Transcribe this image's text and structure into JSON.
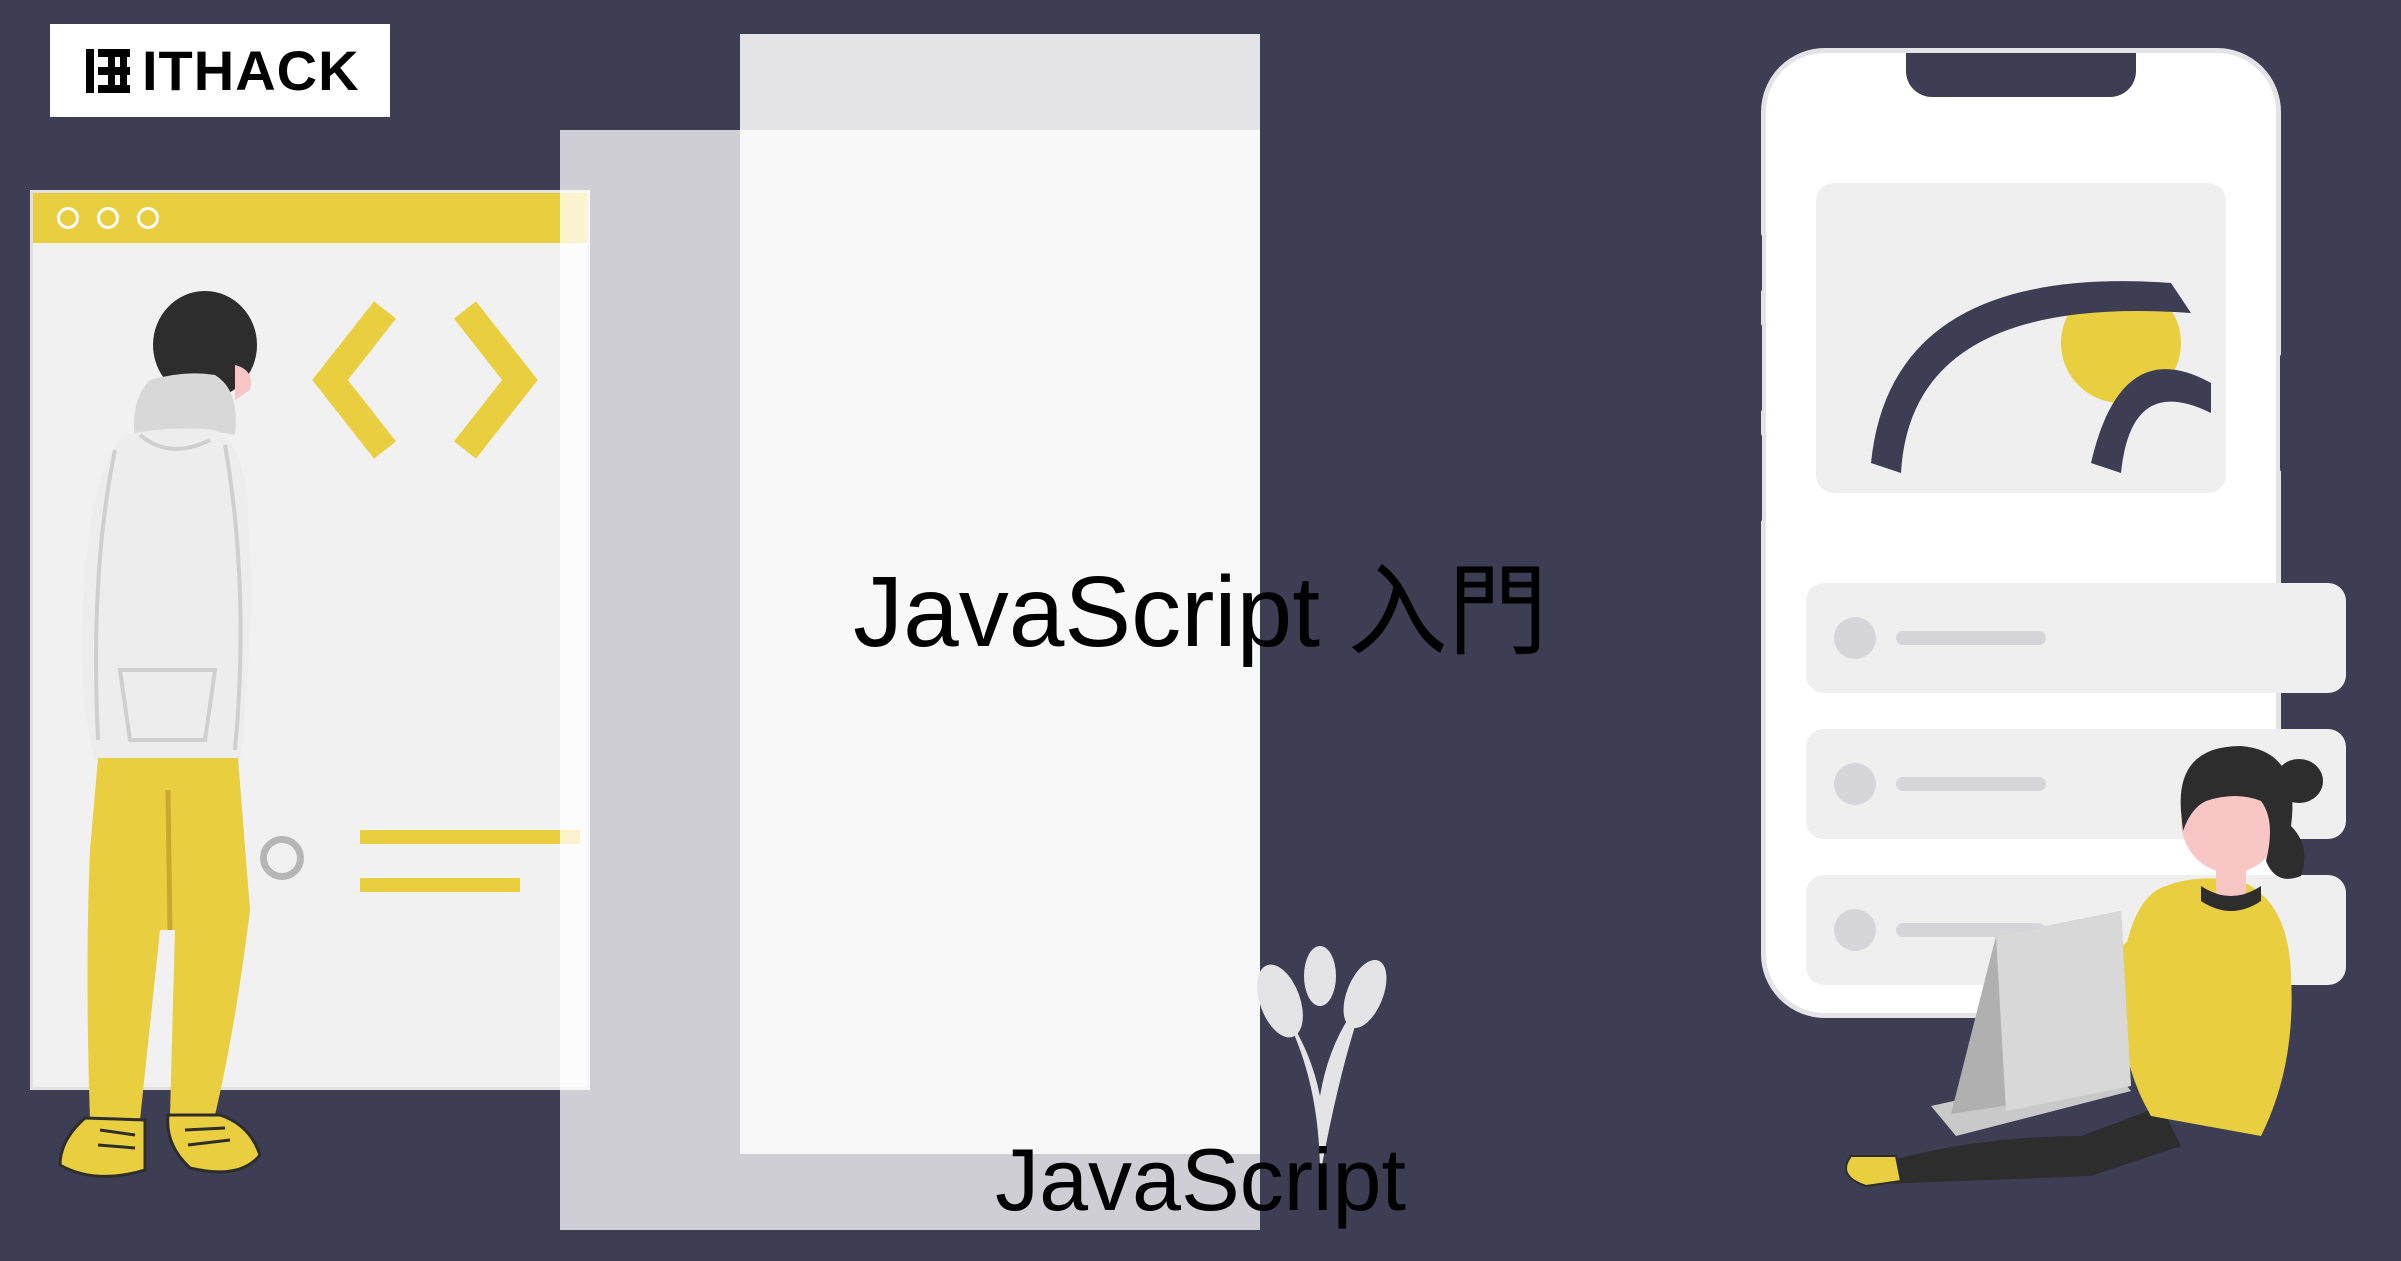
{
  "logo": {
    "text": "ITHACK"
  },
  "title": "JavaScript 入門",
  "subtitle": "JavaScript",
  "colors": {
    "background": "#3d3d54",
    "accent": "#e9cf3f",
    "skin": "#f9c6c6"
  }
}
